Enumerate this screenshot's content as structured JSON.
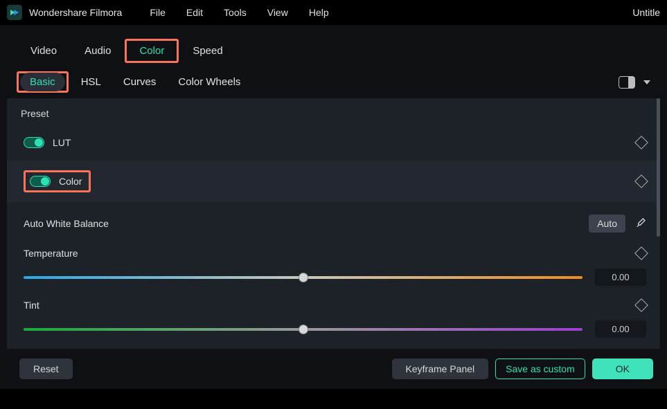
{
  "app": {
    "title": "Wondershare Filmora",
    "docTitle": "Untitle"
  },
  "menu": {
    "file": "File",
    "edit": "Edit",
    "tools": "Tools",
    "view": "View",
    "help": "Help"
  },
  "propTabs": {
    "video": "Video",
    "audio": "Audio",
    "color": "Color",
    "speed": "Speed"
  },
  "subTabs": {
    "basic": "Basic",
    "hsl": "HSL",
    "curves": "Curves",
    "colorWheels": "Color Wheels"
  },
  "panel": {
    "preset": "Preset",
    "lut": "LUT",
    "color": "Color",
    "awb": "Auto White Balance",
    "auto": "Auto",
    "temperature": {
      "label": "Temperature",
      "value": "0.00",
      "pos": 50
    },
    "tint": {
      "label": "Tint",
      "value": "0.00",
      "pos": 50
    }
  },
  "footer": {
    "reset": "Reset",
    "keyframe": "Keyframe Panel",
    "saveCustom": "Save as custom",
    "ok": "OK"
  }
}
